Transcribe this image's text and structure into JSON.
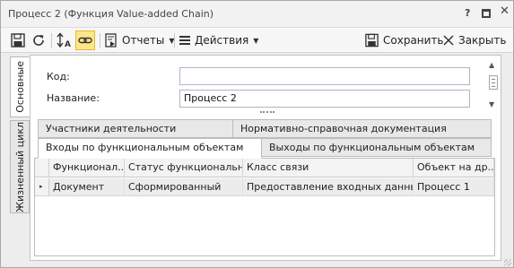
{
  "window": {
    "title": "Процесс 2 (Функция Value-added Chain)",
    "help_label": "?",
    "close_glyph": "✕"
  },
  "toolbar": {
    "reports_label": "Отчеты",
    "actions_label": "Действия",
    "save_label": "Сохранить",
    "close_label": "Закрыть"
  },
  "side_tabs": [
    {
      "label": "Основные",
      "active": true
    },
    {
      "label": "Жизненный цикл",
      "active": false
    }
  ],
  "form": {
    "code_label": "Код:",
    "code_value": "",
    "name_label": "Название:",
    "name_value": "Процесс 2"
  },
  "tabs": {
    "row1": [
      "Участники деятельности",
      "Нормативно-справочная документация"
    ],
    "row2": [
      "Входы по функциональным объектам",
      "Выходы по функциональным объектам"
    ],
    "active": "Входы по функциональным объектам"
  },
  "grid": {
    "columns": [
      "Функционал...",
      "Статус функциональн...",
      "Класс связи",
      "Объект на др..."
    ],
    "rows": [
      [
        "Документ",
        "Сформированный",
        "Предоставление входных данных",
        "Процесс 1"
      ]
    ],
    "row_marker": "▸"
  },
  "colors": {
    "active_tool": "#fde68a",
    "window_bg": "#ededed",
    "row_bg": "#ececec"
  },
  "icons": [
    "save-icon",
    "refresh-icon",
    "sort-icon",
    "link-icon",
    "reports-icon",
    "menu-icon",
    "save-icon",
    "close-icon"
  ]
}
